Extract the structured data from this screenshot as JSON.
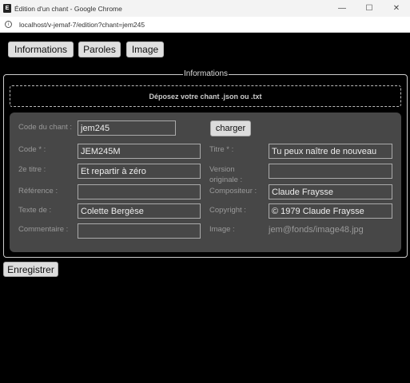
{
  "window": {
    "title": "Édition d'un chant - Google Chrome",
    "app_icon_letter": "E",
    "url": "localhost/v-jemaf-7/edition?chant=jem245"
  },
  "tabs": [
    {
      "label": "Informations"
    },
    {
      "label": "Paroles"
    },
    {
      "label": "Image"
    }
  ],
  "form": {
    "legend": "Informations",
    "dropzone_text": "Déposez votre chant .json ou .txt",
    "code_chant": {
      "label": "Code du chant :",
      "value": "jem245"
    },
    "charger_label": "charger",
    "code": {
      "label": "Code * :",
      "value": "JEM245M"
    },
    "titre": {
      "label": "Titre * :",
      "value": "Tu peux naître de nouveau"
    },
    "second_titre": {
      "label": "2e titre :",
      "value": "Et repartir à zéro"
    },
    "version_originale": {
      "label_line1": "Version",
      "label_line2": "originale :",
      "value": ""
    },
    "reference": {
      "label": "Référence :",
      "value": ""
    },
    "compositeur": {
      "label": "Compositeur :",
      "value": "Claude Fraysse"
    },
    "texte_de": {
      "label": "Texte de :",
      "value": "Colette Bergèse"
    },
    "copyright": {
      "label": "Copyright :",
      "value": "© 1979 Claude Fraysse"
    },
    "commentaire": {
      "label": "Commentaire :",
      "value": ""
    },
    "image": {
      "label": "Image :",
      "value": "jem@fonds/image48.jpg"
    }
  },
  "save_label": "Enregistrer"
}
